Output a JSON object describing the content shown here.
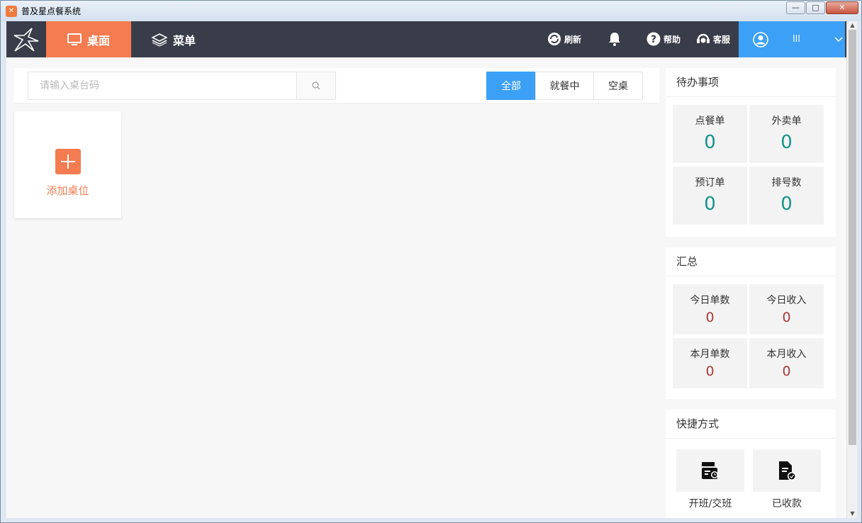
{
  "window": {
    "title": "普及星点餐系统",
    "minimize": "—",
    "maximize": "□",
    "close": "✕"
  },
  "nav": {
    "tabs": [
      {
        "label": "桌面",
        "icon": "monitor-icon",
        "active": true
      },
      {
        "label": "菜单",
        "icon": "layers-icon",
        "active": false
      }
    ],
    "tools": {
      "refresh": "刷新",
      "help": "帮助",
      "service": "客服"
    },
    "user": {
      "name": "lll"
    }
  },
  "search": {
    "placeholder": "请输入桌台码"
  },
  "filters": [
    {
      "label": "全部",
      "active": true
    },
    {
      "label": "就餐中",
      "active": false
    },
    {
      "label": "空桌",
      "active": false
    }
  ],
  "add_table": {
    "label": "添加桌位"
  },
  "todo": {
    "title": "待办事项",
    "items": [
      {
        "label": "点餐单",
        "value": "0"
      },
      {
        "label": "外卖单",
        "value": "0"
      },
      {
        "label": "预订单",
        "value": "0"
      },
      {
        "label": "排号数",
        "value": "0"
      }
    ]
  },
  "summary": {
    "title": "汇总",
    "items": [
      {
        "label": "今日单数",
        "value": "0"
      },
      {
        "label": "今日收入",
        "value": "0"
      },
      {
        "label": "本月单数",
        "value": "0"
      },
      {
        "label": "本月收入",
        "value": "0"
      }
    ]
  },
  "shortcuts": {
    "title": "快捷方式",
    "items": [
      {
        "label": "开班/交班",
        "icon": "shift-handover-icon"
      },
      {
        "label": "已收款",
        "icon": "paid-receipt-icon"
      }
    ]
  },
  "colors": {
    "topbar": "#393d49",
    "accent_orange": "#f47c50",
    "accent_blue": "#3ca0f6",
    "teal_value": "#14958a",
    "red_value": "#a83a3a"
  }
}
